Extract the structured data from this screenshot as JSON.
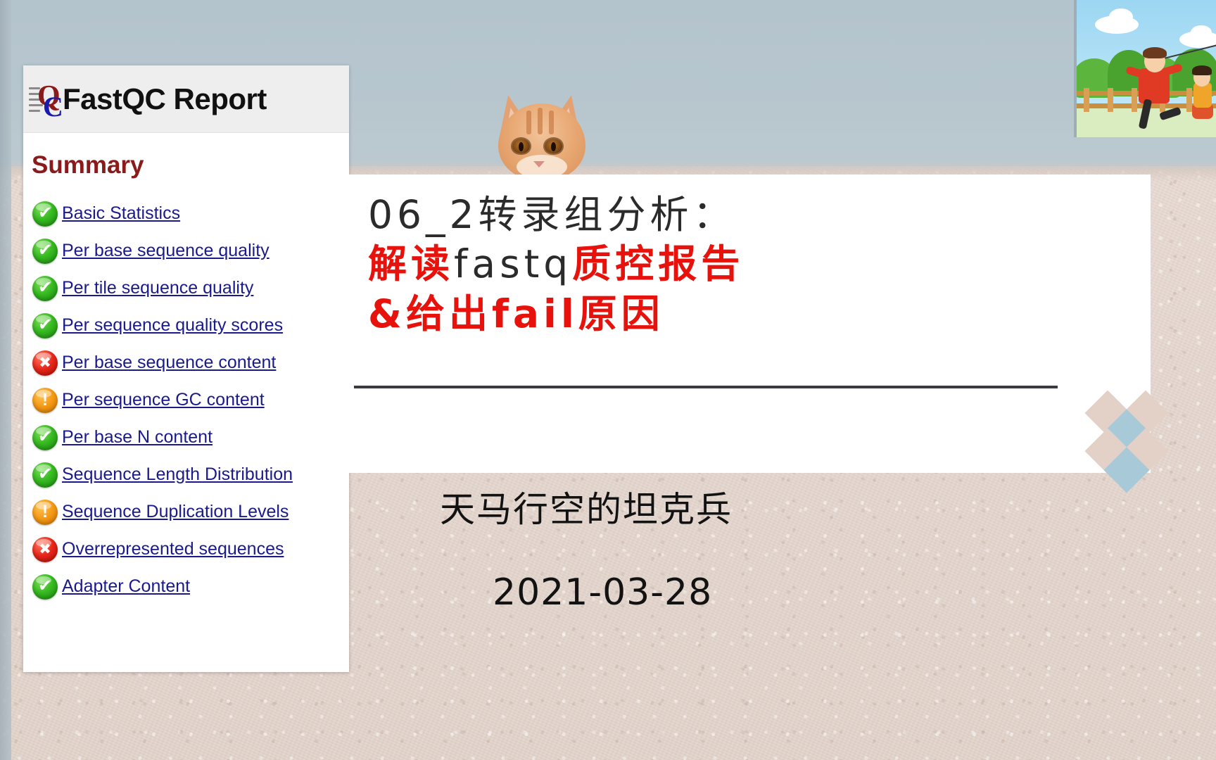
{
  "background": {
    "sky_color": "#b4c4cd",
    "wall_color": "#e3d5cd"
  },
  "fastqc_report": {
    "title": "FastQC Report",
    "logo_q": "Q",
    "logo_c": "C",
    "summary_heading": "Summary",
    "items": [
      {
        "label": "Basic Statistics",
        "status": "pass",
        "glyph": "✔"
      },
      {
        "label": "Per base sequence quality",
        "status": "pass",
        "glyph": "✔"
      },
      {
        "label": "Per tile sequence quality",
        "status": "pass",
        "glyph": "✔"
      },
      {
        "label": "Per sequence quality scores",
        "status": "pass",
        "glyph": "✔"
      },
      {
        "label": "Per base sequence content",
        "status": "fail",
        "glyph": "✖"
      },
      {
        "label": "Per sequence GC content",
        "status": "warn",
        "glyph": "!"
      },
      {
        "label": "Per base N content",
        "status": "pass",
        "glyph": "✔"
      },
      {
        "label": "Sequence Length Distribution",
        "status": "pass",
        "glyph": "✔"
      },
      {
        "label": "Sequence Duplication Levels",
        "status": "warn",
        "glyph": "!"
      },
      {
        "label": "Overrepresented sequences",
        "status": "fail",
        "glyph": "✖"
      },
      {
        "label": "Adapter Content",
        "status": "pass",
        "glyph": "✔"
      }
    ],
    "status_colors": {
      "pass": "#34b81f",
      "warn": "#f59a14",
      "fail": "#e8261a"
    },
    "link_color": "#1a1a8c",
    "heading_color": "#8b1a1a"
  },
  "slide": {
    "title_line1_black": "06_2转录组分析：",
    "title_line2_red_a": "解读",
    "title_line2_black": "fastq",
    "title_line2_red_b": "质控报告",
    "title_line3_red": "&给出fail原因",
    "red_color": "#e8120c",
    "black_color": "#2b2b2b",
    "subtitle": "天马行空的坦克兵",
    "date": "2021-03-28",
    "diamond_beige": "#e3d1c8",
    "diamond_blue": "#a8c9d8"
  },
  "media": {
    "cat_photo": "orange-tabby-cat-peeking",
    "cartoon": "kite-flying-children-illustration"
  }
}
